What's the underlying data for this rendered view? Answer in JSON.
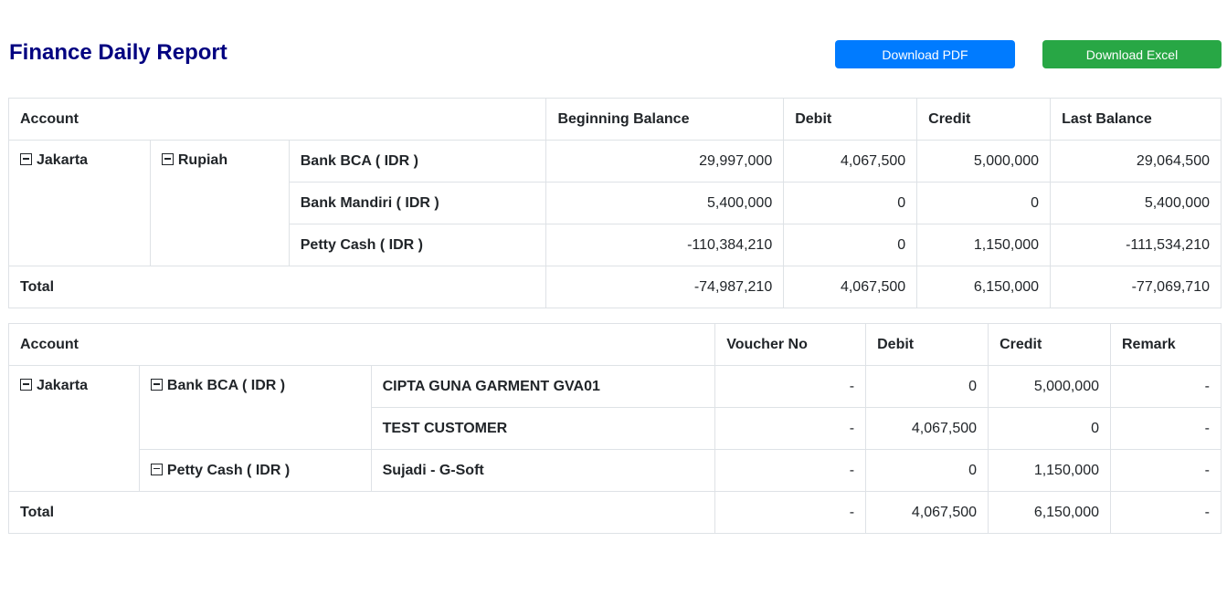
{
  "title": "Finance Daily Report",
  "buttons": {
    "pdf": "Download PDF",
    "excel": "Download Excel"
  },
  "colors": {
    "title": "#000080",
    "pdf_button": "#007bff",
    "excel_button": "#28a745"
  },
  "summary": {
    "headers": [
      "Account",
      "Beginning Balance",
      "Debit",
      "Credit",
      "Last Balance"
    ],
    "branch": "Jakarta",
    "currency": "Rupiah",
    "rows": [
      {
        "account": "Bank BCA ( IDR )",
        "beginning": "29,997,000",
        "debit": "4,067,500",
        "credit": "5,000,000",
        "last": "29,064,500"
      },
      {
        "account": "Bank Mandiri ( IDR )",
        "beginning": "5,400,000",
        "debit": "0",
        "credit": "0",
        "last": "5,400,000"
      },
      {
        "account": "Petty Cash ( IDR )",
        "beginning": "-110,384,210",
        "debit": "0",
        "credit": "1,150,000",
        "last": "-111,534,210"
      }
    ],
    "total": {
      "label": "Total",
      "beginning": "-74,987,210",
      "debit": "4,067,500",
      "credit": "6,150,000",
      "last": "-77,069,710"
    }
  },
  "detail": {
    "headers": [
      "Account",
      "Voucher No",
      "Debit",
      "Credit",
      "Remark"
    ],
    "branch": "Jakarta",
    "groups": [
      {
        "account": "Bank BCA ( IDR )",
        "rows": [
          {
            "name": "CIPTA GUNA GARMENT GVA01",
            "voucher": "-",
            "debit": "0",
            "credit": "5,000,000",
            "remark": "-"
          },
          {
            "name": "TEST CUSTOMER",
            "voucher": "-",
            "debit": "4,067,500",
            "credit": "0",
            "remark": "-"
          }
        ]
      },
      {
        "account": "Petty Cash ( IDR )",
        "rows": [
          {
            "name": "Sujadi - G-Soft",
            "voucher": "-",
            "debit": "0",
            "credit": "1,150,000",
            "remark": "-"
          }
        ]
      }
    ],
    "total": {
      "label": "Total",
      "voucher": "-",
      "debit": "4,067,500",
      "credit": "6,150,000",
      "remark": "-"
    }
  }
}
